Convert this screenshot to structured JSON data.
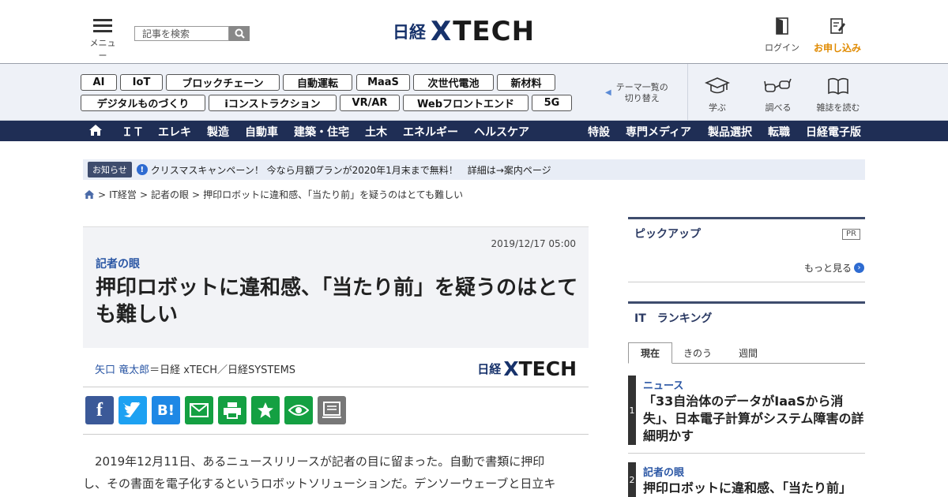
{
  "header": {
    "menu_label": "メニュー",
    "search_placeholder": "記事を検索",
    "logo_nikkei": "日経",
    "logo_x": "X",
    "logo_tech": "TECH",
    "login_label": "ログイン",
    "apply_label": "お申し込み"
  },
  "topics": {
    "tags": [
      "AI",
      "IoT",
      "ブロックチェーン",
      "自動運転",
      "MaaS",
      "次世代電池",
      "新材料",
      "デジタルものづくり",
      "iコンストラクション",
      "VR/AR",
      "Webフロントエンド",
      "5G"
    ],
    "theme_switch": [
      "テーマ一覧の",
      "切り替え"
    ],
    "tools": [
      "学ぶ",
      "調べる",
      "雑誌を読む"
    ]
  },
  "nav": {
    "left": [
      "ＩＴ",
      "エレキ",
      "製造",
      "自動車",
      "建築・住宅",
      "土木",
      "エネルギー",
      "ヘルスケア"
    ],
    "right": [
      "特設",
      "専門メディア",
      "製品選択",
      "転職",
      "日経電子版"
    ]
  },
  "notice": {
    "badge": "お知らせ",
    "text": "クリスマスキャンペーン！ 今なら月額プランが2020年1月末まで無料！　詳細は→案内ページ"
  },
  "breadcrumb": [
    "IT経営",
    "記者の眼",
    "押印ロボットに違和感、「当たり前」を疑うのはとても難しい"
  ],
  "article": {
    "date": "2019/12/17 05:00",
    "category": "記者の眼",
    "title": "押印ロボットに違和感、「当たり前」を疑うのはとても難しい",
    "author_name": "矢口 竜太郎",
    "author_affiliation": "＝日経 xTECH／日経SYSTEMS",
    "body_lines": [
      "　2019年12月11日、あるニュースリリースが記者の目に留まった。自動で書類に押印",
      "し、その書面を電子化するというロボットソリューションだ。デンソーウェーブと日立キ"
    ]
  },
  "share_buttons": {
    "facebook": "f",
    "hatena": "B!"
  },
  "sidebar": {
    "pickup_title": "ピックアップ",
    "pr": "PR",
    "more": "もっと見る",
    "ranking_title": "IT　ランキング",
    "tabs": [
      "現在",
      "きのう",
      "週間"
    ],
    "ranking": [
      {
        "num": "1",
        "category": "ニュース",
        "title": "「33自治体のデータがIaaSから消失」、日本電子計算がシステム障害の詳細明かす"
      },
      {
        "num": "2",
        "category": "記者の眼",
        "title": "押印ロボットに違和感、「当たり前」"
      }
    ]
  },
  "colors": {
    "navy": "#1f2e55",
    "accent_blue": "#2a56a4",
    "apply_orange": "#e08a00",
    "facebook": "#3b5998",
    "twitter": "#1da1f2",
    "hatena": "#1e88e5",
    "green": "#14a042",
    "gray": "#777777"
  }
}
